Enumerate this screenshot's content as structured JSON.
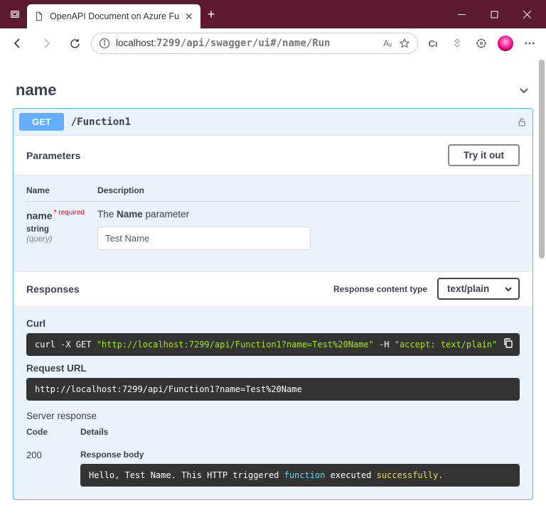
{
  "browser": {
    "tab_title": "OpenAPI Document on Azure Fu",
    "url_host": "localhost:",
    "url_path": "7299/api/swagger/ui#/name/Run",
    "addr_reader": "Aᵥ",
    "collections": "Cι"
  },
  "tag": {
    "name": "name"
  },
  "op": {
    "method": "GET",
    "path": "/Function1"
  },
  "params": {
    "section_title": "Parameters",
    "tryout_label": "Try it out",
    "th_name": "Name",
    "th_desc": "Description",
    "p_name": "name",
    "p_required": "* required",
    "p_type": "string",
    "p_in": "(query)",
    "p_desc_pre": "The ",
    "p_desc_b": "Name",
    "p_desc_post": " parameter",
    "p_value": "Test Name"
  },
  "resp": {
    "title": "Responses",
    "ct_label": "Response content type",
    "ct_value": "text/plain"
  },
  "exec": {
    "curl_h": "Curl",
    "curl_cmd": "curl -X GET ",
    "curl_url": "\"http://localhost:7299/api/Function1?name=Test%20Name\"",
    "curl_h_flag": " -H  ",
    "curl_accept": "\"accept: text/plain\"",
    "req_h": "Request URL",
    "req_url": "http://localhost:7299/api/Function1?name=Test%20Name",
    "server_h": "Server response",
    "code_h": "Code",
    "details_h": "Details",
    "code": "200",
    "rb_h": "Response body",
    "rb_1": "Hello, Test Name. This HTTP triggered ",
    "rb_2": "function",
    "rb_3": " executed ",
    "rb_4": "successfully.",
    "rb_5": ""
  }
}
